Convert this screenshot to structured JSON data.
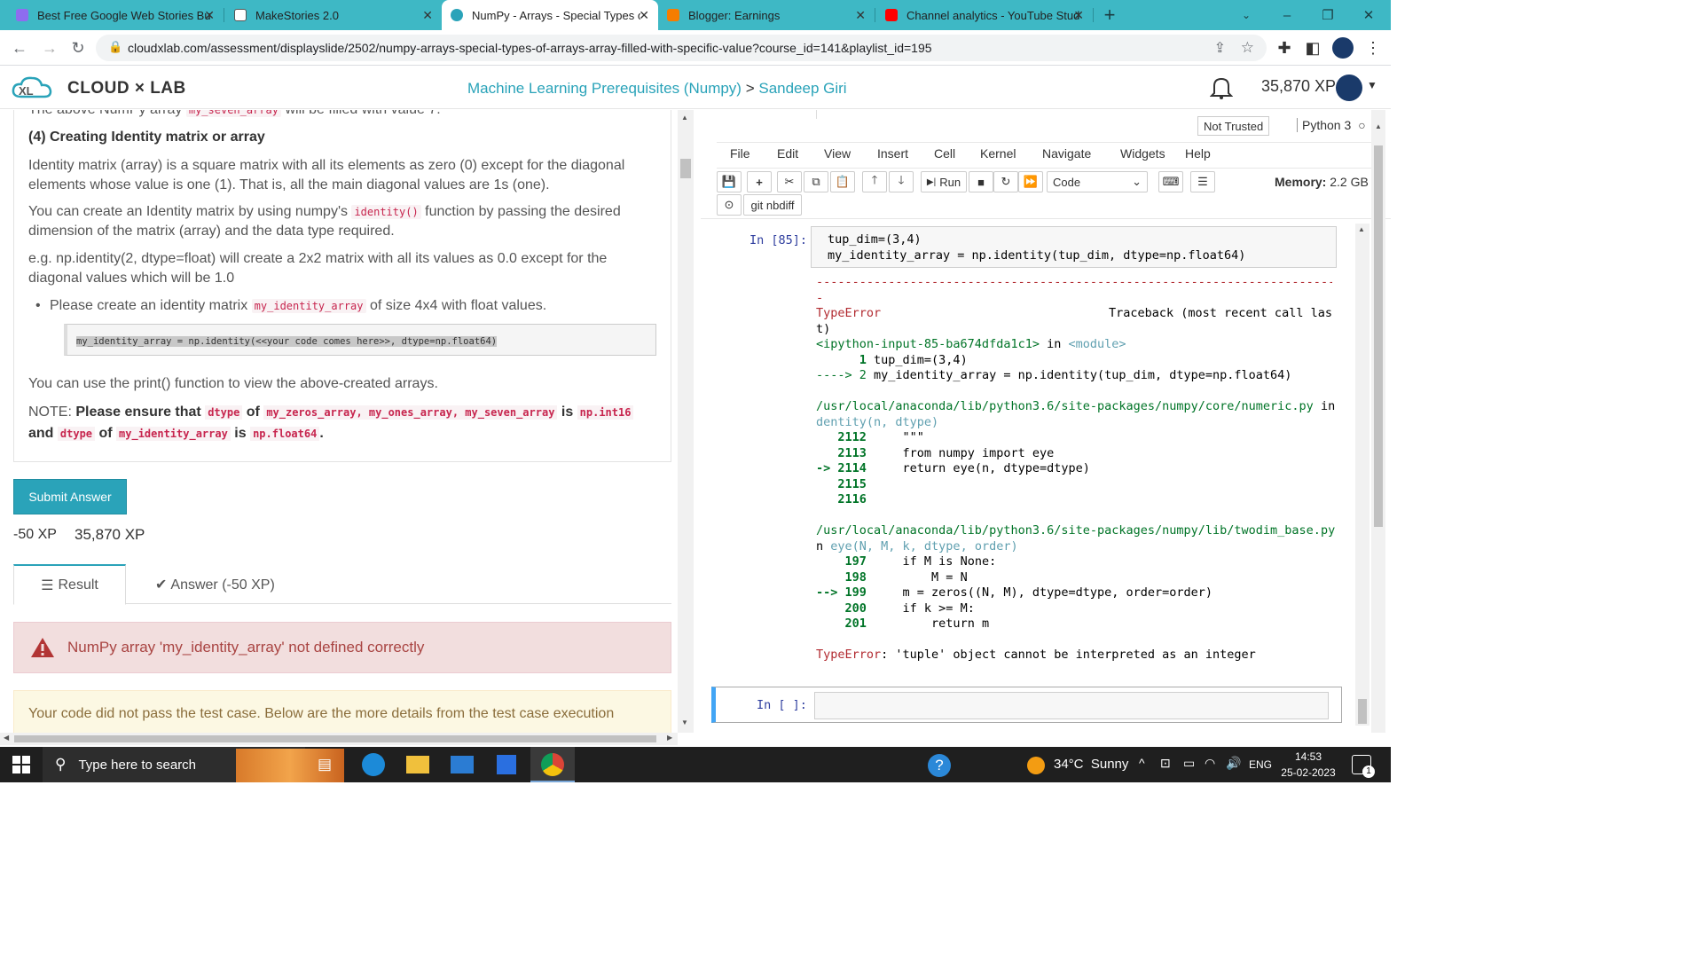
{
  "browser": {
    "tabs": [
      {
        "label": "Best Free Google Web Stories Bu",
        "icon": "webstories-icon",
        "color": "#8e6cef"
      },
      {
        "label": "MakeStories 2.0",
        "icon": "makestories-icon",
        "color": "#ffffff"
      },
      {
        "label": "NumPy - Arrays - Special Types o",
        "icon": "cloudxlab-icon",
        "color": "#2aa3b9"
      },
      {
        "label": "Blogger: Earnings",
        "icon": "blogger-icon",
        "color": "#f57d00"
      },
      {
        "label": "Channel analytics - YouTube Stud",
        "icon": "youtube-icon",
        "color": "#ff0000"
      }
    ],
    "url": "cloudxlab.com/assessment/displayslide/2502/numpy-arrays-special-types-of-arrays-array-filled-with-specific-value?course_id=141&playlist_id=195"
  },
  "site": {
    "logo_text": "CLOUD × LAB",
    "breadcrumb_course": "Machine Learning Prerequisites (Numpy)",
    "breadcrumb_sep": " > ",
    "breadcrumb_author": "Sandeep Giri",
    "xp": "35,870 XP"
  },
  "lesson": {
    "top_cut_prefix": "The above NumPy array ",
    "top_cut_code": "my_seven_array",
    "top_cut_suffix": " will be filled with value 7.",
    "heading": "(4) Creating Identity matrix or array",
    "p1": "Identity matrix (array) is a square matrix with all its elements as zero (0) except for the diagonal elements whose value is one (1). That is, all the main diagonal values are 1s (one).",
    "p2_a": "You can create an Identity matrix by using numpy's ",
    "p2_code": "identity()",
    "p2_b": " function by passing the desired dimension of the matrix (array) and the data type required.",
    "p3": "e.g. np.identity(2, dtype=float) will create a 2x2 matrix with all its values as 0.0 except for the diagonal values which will be 1.0",
    "bullet_a": "Please create an identity matrix ",
    "bullet_code": "my_identity_array",
    "bullet_b": " of size 4x4 with float values.",
    "code_block": "my_identity_array = np.identity(<<your code comes here>>, dtype=np.float64)",
    "p4": "You can use the print() function to view the above-created arrays.",
    "note_label": "NOTE: ",
    "note_a": "Please ensure that ",
    "note_dtype1": "dtype",
    "note_of1": " of ",
    "note_arrays": "my_zeros_array, my_ones_array, my_seven_array",
    "note_is1": " is ",
    "note_int16": "np.int16",
    "note_and": " and ",
    "note_dtype2": "dtype",
    "note_of2": " of ",
    "note_identity": "my_identity_array",
    "note_is2": " is ",
    "note_float64": "np.float64",
    "note_end": ".",
    "submit_label": "Submit Answer",
    "xp_penalty": "-50 XP",
    "xp_total": "35,870 XP",
    "tab_result": "Result",
    "tab_answer": "Answer (-50 XP)",
    "error_msg": "NumPy array 'my_identity_array' not defined correctly",
    "fail_msg": "Your code did not pass the test case. Below are the more details from the test case execution"
  },
  "notebook": {
    "trust": "Not Trusted",
    "kernel": "Python 3",
    "menu": [
      "File",
      "Edit",
      "View",
      "Insert",
      "Cell",
      "Kernel",
      "Navigate",
      "Widgets",
      "Help"
    ],
    "run_label": "Run",
    "cell_type": "Code",
    "memory_label": "Memory:",
    "memory_value": "2.2 GB",
    "nbdiff_label": "git nbdiff",
    "cell_prompt": "In [85]:",
    "cell_line1": "tup_dim=(3,4)",
    "cell_line2": "my_identity_array = np.identity(tup_dim, dtype=np.float64)",
    "dashes": "---------------------------------------------------------------------------",
    "err_type": "TypeError",
    "traceback_label": "Traceback (most recent call las",
    "traceback_wrap": "t)",
    "input_file": "<ipython-input-85-ba674dfda1c1>",
    "in_word": " in ",
    "module": "<module>",
    "tb1_l1_no": "      1 ",
    "tb1_l1": "tup_dim=(3,4)",
    "tb1_l2_no": "----> 2 ",
    "tb1_l2": "my_identity_array = np.identity(tup_dim, dtype=np.float64)",
    "path1": "/usr/local/anaconda/lib/python3.6/site-packages/numpy/core/numeric.py",
    "path1_in": " in i",
    "path1_fn": "dentity(n, dtype)",
    "tb2": [
      {
        "no": "   2112 ",
        "code": "    \"\"\""
      },
      {
        "no": "   2113 ",
        "code": "    from numpy import eye"
      },
      {
        "no": "-> 2114 ",
        "code": "    return eye(n, dtype=dtype)"
      },
      {
        "no": "   2115 ",
        "code": ""
      },
      {
        "no": "   2116 ",
        "code": ""
      }
    ],
    "path2": "/usr/local/anaconda/lib/python3.6/site-packages/numpy/lib/twodim_base.py",
    "path2_in": " i",
    "path2_fn_prefix": "n ",
    "path2_fn": "eye(N, M, k, dtype, order)",
    "tb3": [
      {
        "no": "    197 ",
        "code": "    if M is None:"
      },
      {
        "no": "    198 ",
        "code": "        M = N"
      },
      {
        "no": "--> 199 ",
        "code": "    m = zeros((N, M), dtype=dtype, order=order)"
      },
      {
        "no": "    200 ",
        "code": "    if k >= M:"
      },
      {
        "no": "    201 ",
        "code": "        return m"
      }
    ],
    "final_err_type": "TypeError",
    "final_err_msg": ": 'tuple' object cannot be interpreted as an integer",
    "empty_prompt": "In [ ]:"
  },
  "taskbar": {
    "search_placeholder": "Type here to search",
    "weather": "34°C  Sunny",
    "lang": "ENG",
    "time": "14:53",
    "date": "25-02-2023",
    "notif_count": "1"
  }
}
